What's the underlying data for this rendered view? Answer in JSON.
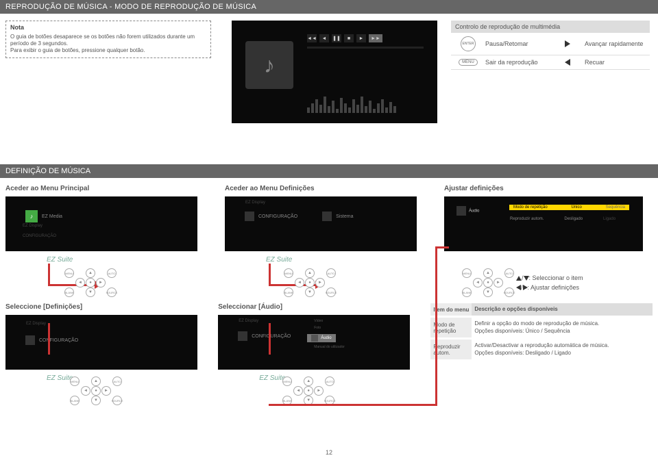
{
  "page_title": "REPRODUÇÃO DE MÚSICA - MODO DE REPRODUÇÃO DE MÚSICA",
  "note": {
    "heading": "Nota",
    "line1": "O guia de botões desaparece se os botões não forem utilizados durante um período de 3 segundos.",
    "line2": "Para exibir o guia de botões, pressione qualquer botão."
  },
  "control_table": {
    "title": "Controlo de reprodução de multimédia",
    "rows": [
      {
        "btn": "ENTER",
        "label": "Pausa/Retomar",
        "arrow": "right",
        "arrow_label": "Avançar rapidamente"
      },
      {
        "btn": "MENU",
        "label": "Sair da reprodução",
        "arrow": "left",
        "arrow_label": "Recuar"
      }
    ]
  },
  "definition_section": {
    "title": "DEFINIÇÃO DE MÚSICA",
    "col1_title": "Aceder ao Menu Principal",
    "col2_title": "Aceder ao Menu Definições",
    "col3_title": "Ajustar definições",
    "ez_media": "EZ Media",
    "ez_display": "EZ Display",
    "configuracao": "CONFIGURAÇÃO",
    "ez_suite": "EZ Suite",
    "sistema": "Sistema",
    "audio": "Áudio",
    "modo_repeticao": "Modo de repetição",
    "unico": "Único",
    "sequencia": "Sequência",
    "reproduzir_autom": "Reproduzir autom.",
    "desligado": "Desligado",
    "ligado": "Ligado",
    "foto": "Foto",
    "video": "Vídeo",
    "manual_utilizador": "Manual do utilizador"
  },
  "legend": {
    "item_select": ": Seleccionar o item",
    "adjust": ": Ajustar definições"
  },
  "bottom": {
    "col1_title": "Seleccione [Definições]",
    "col2_title": "Seleccionar [Áudio]"
  },
  "desc_table": {
    "header1": "Item do menu",
    "header2": "Descrição e opções disponíveis",
    "rows": [
      {
        "name": "Modo de repetição",
        "desc": "Definir a opção do modo de reprodução de música.",
        "opts": "Opções disponíveis: Único / Sequência"
      },
      {
        "name": "Reproduzir autom.",
        "desc": "Activar/Desactivar a reprodução automática de música.",
        "opts": "Opções disponíveis: Desligado / Ligado"
      }
    ]
  },
  "page_number": "12"
}
